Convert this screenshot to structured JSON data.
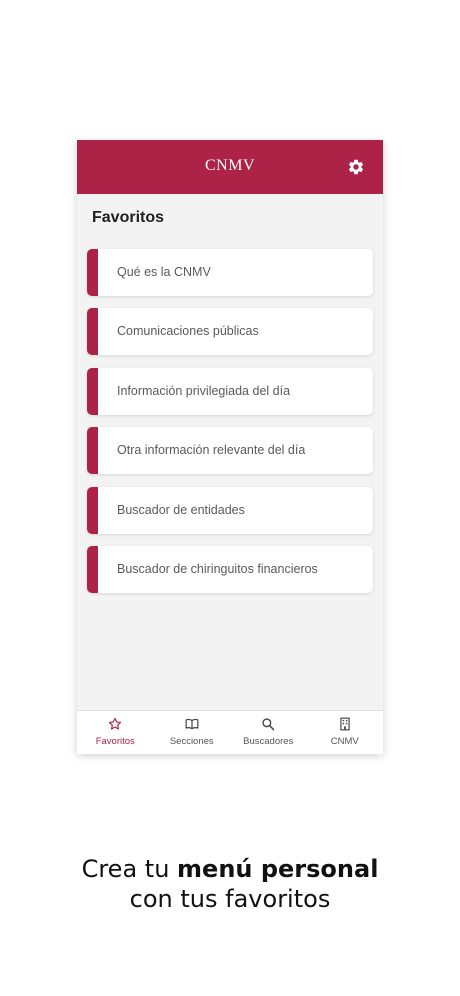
{
  "app": {
    "logo_text": "CNMV"
  },
  "page": {
    "title": "Favoritos"
  },
  "favorites": [
    {
      "label": "Qué es la CNMV"
    },
    {
      "label": "Comunicaciones públicas"
    },
    {
      "label": "Información privilegiada del día"
    },
    {
      "label": "Otra información relevante del día"
    },
    {
      "label": "Buscador de entidades"
    },
    {
      "label": "Buscador de chiringuitos financieros"
    }
  ],
  "tabs": [
    {
      "label": "Favoritos",
      "icon": "star-icon",
      "active": true
    },
    {
      "label": "Secciones",
      "icon": "book-icon",
      "active": false
    },
    {
      "label": "Buscadores",
      "icon": "search-icon",
      "active": false
    },
    {
      "label": "CNMV",
      "icon": "building-icon",
      "active": false
    }
  ],
  "tagline": {
    "line1_prefix": "Crea tu ",
    "line1_bold": "menú personal",
    "line2": "con tus favoritos"
  },
  "colors": {
    "brand": "#ad2347",
    "background": "#f3f3f3",
    "text": "#5a5a5a"
  }
}
